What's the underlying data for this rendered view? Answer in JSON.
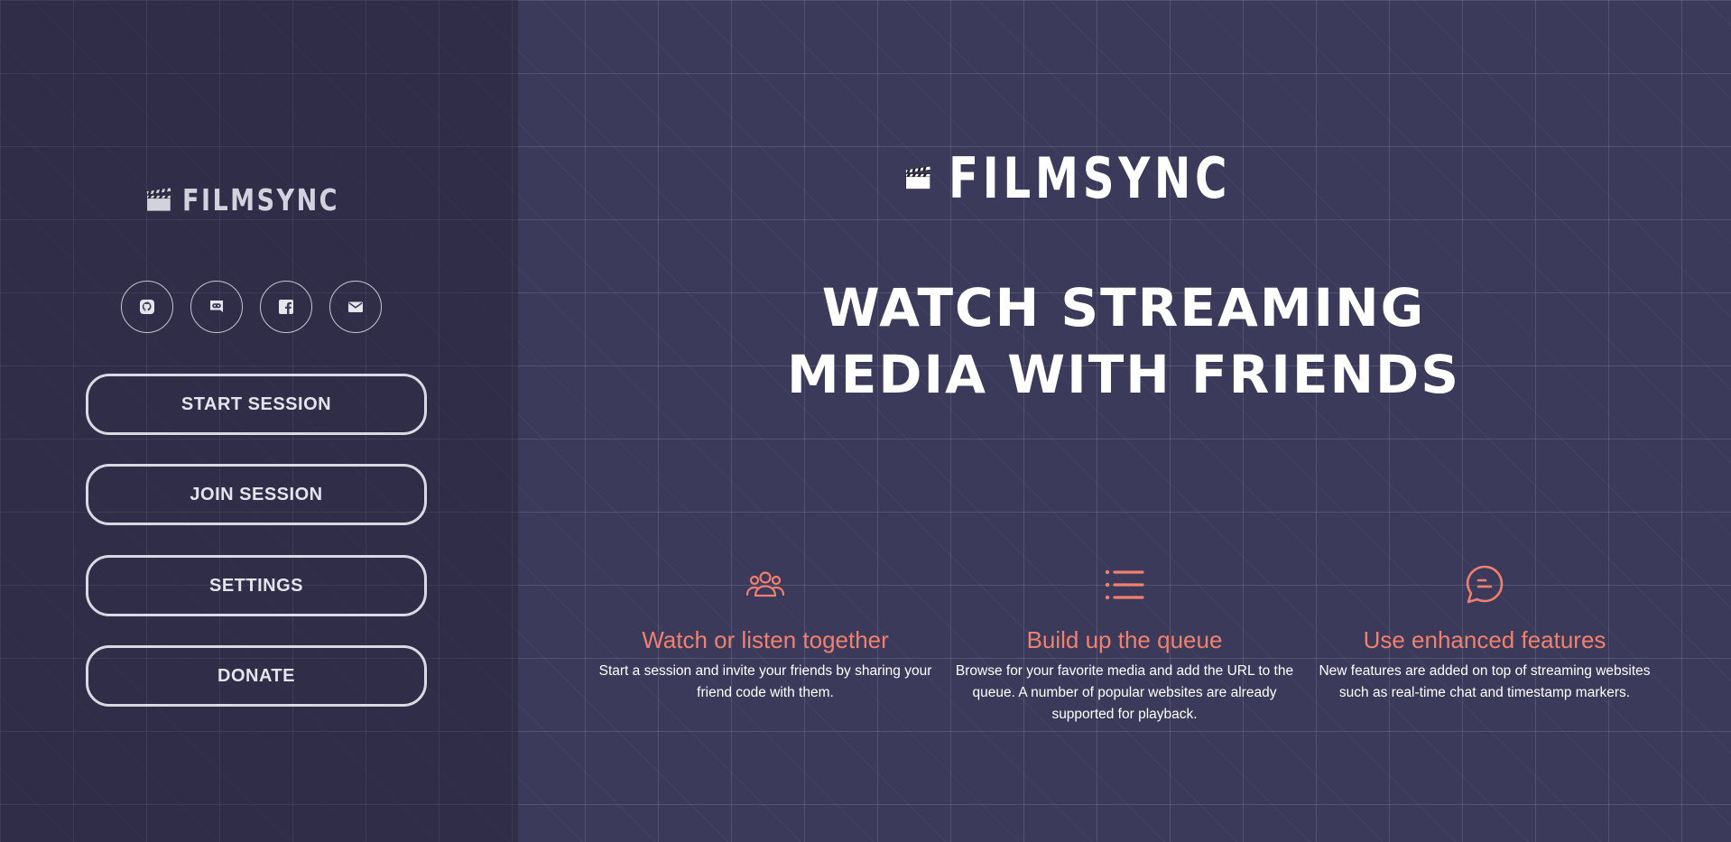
{
  "brand": {
    "name": "FILMSYNC",
    "accent_color": "#f1806e",
    "background_color": "#3b3a5a"
  },
  "sidebar": {
    "social_links": [
      {
        "icon": "github-icon",
        "name": "github-button"
      },
      {
        "icon": "discord-icon",
        "name": "discord-button"
      },
      {
        "icon": "facebook-icon",
        "name": "facebook-button"
      },
      {
        "icon": "email-icon",
        "name": "email-button"
      }
    ],
    "buttons": [
      {
        "label": "START SESSION"
      },
      {
        "label": "JOIN SESSION"
      },
      {
        "label": "SETTINGS"
      },
      {
        "label": "DONATE"
      }
    ]
  },
  "hero": {
    "headline_line1": "WATCH STREAMING",
    "headline_line2": "MEDIA WITH FRIENDS"
  },
  "features": [
    {
      "icon": "users-icon",
      "title": "Watch or listen together",
      "description": "Start a session and invite your friends by sharing your friend code with them."
    },
    {
      "icon": "list-icon",
      "title": "Build up the queue",
      "description": "Browse for your favorite media and add the URL to the queue. A number of popular websites are already supported for playback."
    },
    {
      "icon": "chat-bubble-icon",
      "title": "Use enhanced features",
      "description": "New features are added on top of streaming websites such as real-time chat and timestamp markers."
    }
  ]
}
